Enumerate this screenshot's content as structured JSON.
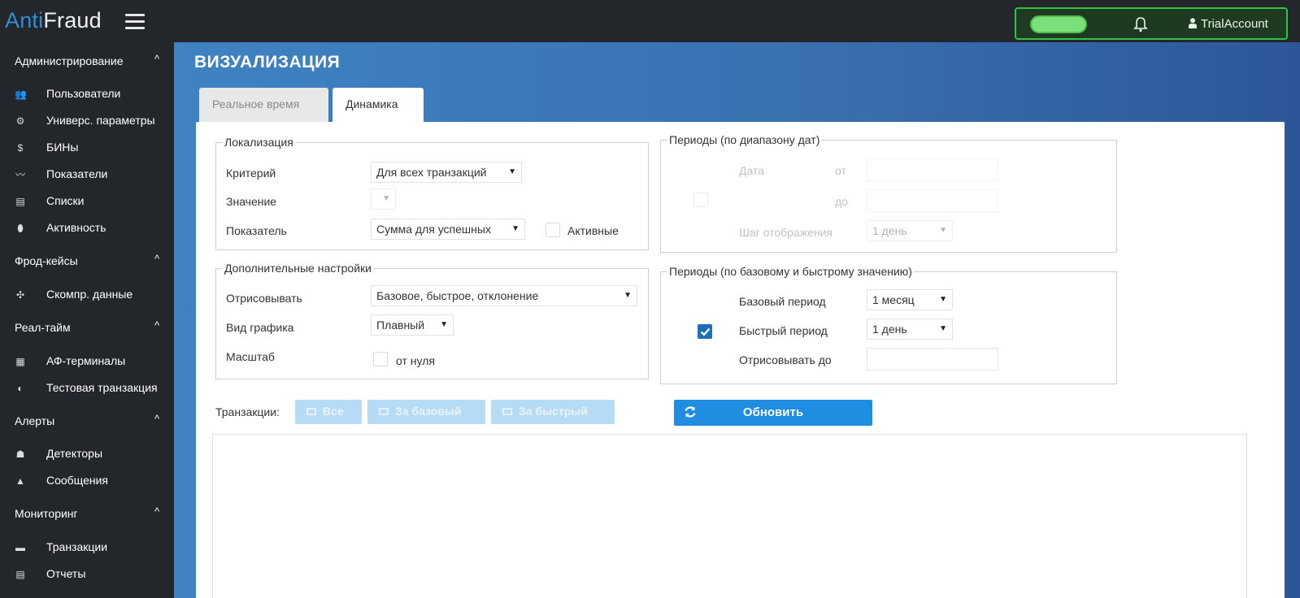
{
  "app": {
    "logo_part1": "Anti",
    "logo_part2": "Fraud",
    "account": "TrialAccount"
  },
  "icons": {
    "menu": "hamburger-icon",
    "bell": "bell-icon",
    "user": "user-icon",
    "refresh": "refresh-icon",
    "checkbox": "check-icon"
  },
  "colors": {
    "accent": "#1f8de0",
    "status_green": "#2fc244",
    "sidebar_bg": "#23272b",
    "header_blue": "#3e83c3"
  },
  "sidebar": {
    "sections": [
      {
        "label": "Администрирование",
        "items": [
          "Пользователи",
          "Универс. параметры",
          "БИНы",
          "Показатели",
          "Списки",
          "Активность"
        ]
      },
      {
        "label": "Фрод-кейсы",
        "items": [
          "Скомпр. данные"
        ]
      },
      {
        "label": "Реал-тайм",
        "items": [
          "АФ-терминалы",
          "Тестовая транзакция"
        ]
      },
      {
        "label": "Алерты",
        "items": [
          "Детекторы",
          "Сообщения"
        ]
      },
      {
        "label": "Мониторинг",
        "items": [
          "Транзакции",
          "Отчеты"
        ]
      }
    ],
    "icon_glyphs": {
      "users": "👥",
      "params": "⚙",
      "bins": "$",
      "indicators": "〰",
      "lists": "▤",
      "activity": "⬮",
      "compressed": "✣",
      "terminals": "▦",
      "test": "◐",
      "detectors": "☗",
      "messages": "▲",
      "transactions": "▬",
      "reports": "▤"
    }
  },
  "page": {
    "title": "ВИЗУАЛИЗАЦИЯ",
    "tabs": [
      "Реальное время",
      "Динамика"
    ]
  },
  "localization": {
    "legend": "Локализация",
    "criterion_label": "Критерий",
    "criterion_value": "Для всех транзакций",
    "value_label": "Значение",
    "indicator_label": "Показатель",
    "indicator_value": "Сумма для успешных",
    "active_label": "Активные"
  },
  "additional": {
    "legend": "Дополнительные настройки",
    "draw_label": "Отрисовывать",
    "draw_value": "Базовое, быстрое, отклонение",
    "chart_type_label": "Вид графика",
    "chart_type_value": "Плавный",
    "scale_label": "Масштаб",
    "from_zero_label": "от нуля"
  },
  "periods_dates": {
    "legend": "Периоды (по диапазону дат)",
    "date_label": "Дата",
    "from_label": "от",
    "to_label": "до",
    "step_label": "Шаг отображения",
    "step_value": "1 день"
  },
  "periods_values": {
    "legend": "Периоды (по базовому и быстрому значению)",
    "base_label": "Базовый период",
    "base_value": "1 месяц",
    "fast_label": "Быстрый период",
    "fast_value": "1 день",
    "draw_until_label": "Отрисовывать до"
  },
  "transactions": {
    "label": "Транзакции:",
    "buttons": [
      "Все",
      "За базовый",
      "За быстрый"
    ],
    "refresh": "Обновить"
  }
}
